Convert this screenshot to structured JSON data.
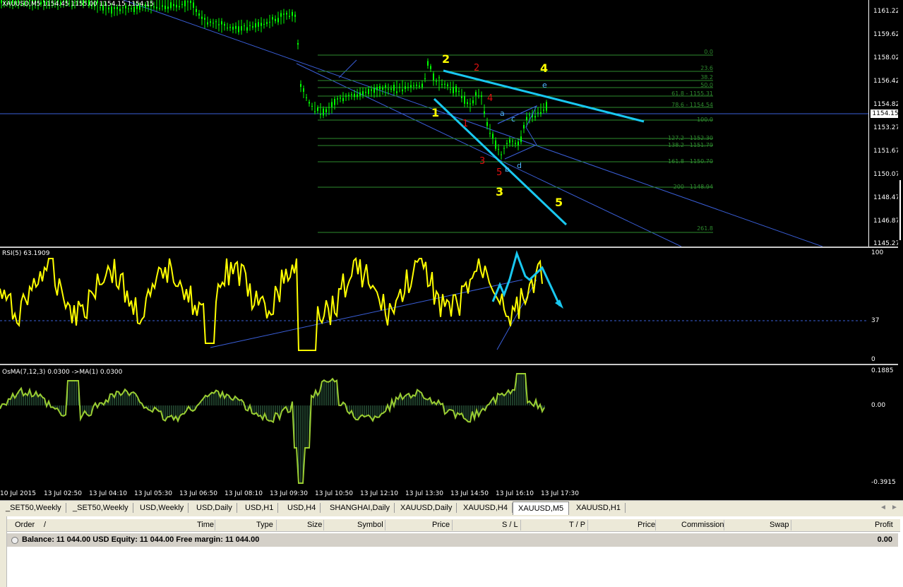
{
  "main_chart": {
    "title": "XAUUSD,M5  1154.45 1155.00 1154.15 1154.15",
    "price_labels": [
      "1161.22",
      "1159.62",
      "1158.02",
      "1156.42",
      "1154.82",
      "1153.27",
      "1151.67",
      "1150.07",
      "1148.47",
      "1146.87",
      "1145.27"
    ],
    "current_price": "1154.15",
    "fib_labels": [
      "0.0",
      "23.6",
      "38.2",
      "50.0",
      "61.8 - 1155.31",
      "78.6 - 1154.54",
      "100.0",
      "127.2 - 1152.30",
      "138.2 - 1151.79",
      "161.8 - 1150.70",
      "200 - 1148.94",
      "261.8"
    ],
    "wave_labels": {
      "yellow_1": "1",
      "yellow_2": "2",
      "yellow_3": "3",
      "yellow_4": "4",
      "yellow_5": "5",
      "red_1": "1",
      "red_2": "2",
      "red_3": "3",
      "red_4": "4",
      "red_5": "5",
      "blue_a": "a",
      "blue_b": "b",
      "blue_c": "c",
      "blue_d": "d",
      "blue_e": "e"
    }
  },
  "rsi_pane": {
    "title": "RSI(5) 63.1909",
    "levels": [
      "100",
      "37",
      "0"
    ]
  },
  "osma_pane": {
    "title": "OsMA(7,12,3) 0.0300  ->MA(1) 0.0300",
    "levels": [
      "0.1885",
      "0.00",
      "-0.3915"
    ]
  },
  "time_axis": [
    "10 Jul 2015",
    "13 Jul 02:50",
    "13 Jul 04:10",
    "13 Jul 05:30",
    "13 Jul 06:50",
    "13 Jul 08:10",
    "13 Jul 09:30",
    "13 Jul 10:50",
    "13 Jul 12:10",
    "13 Jul 13:30",
    "13 Jul 14:50",
    "13 Jul 16:10",
    "13 Jul 17:30"
  ],
  "chart_tabs": [
    "_SET50,Weekly",
    "_SET50,Weekly",
    "USD,Weekly",
    "USD,Daily",
    "USD,H1",
    "USD,H4",
    "SHANGHAI,Daily",
    "XAUUSD,Daily",
    "XAUUSD,H4",
    "XAUUSD,M5",
    "XAUUSD,H1"
  ],
  "active_tab": "XAUUSD,M5",
  "terminal": {
    "columns": [
      "Order",
      "/",
      "Time",
      "Type",
      "Size",
      "Symbol",
      "Price",
      "S / L",
      "T / P",
      "Price",
      "Commission",
      "Swap",
      "Profit"
    ],
    "balance_text": "Balance: 11 044.00 USD  Equity: 11 044.00  Free margin: 11 044.00",
    "profit": "0.00"
  },
  "colors": {
    "background": "#000000",
    "candle": "#00ff00",
    "rsi_line": "#ffff00",
    "osma_line": "#9acd32",
    "trend_line": "#3a5fd9",
    "annotation": "#19c8f0",
    "fib": "#2e8b2e"
  }
}
